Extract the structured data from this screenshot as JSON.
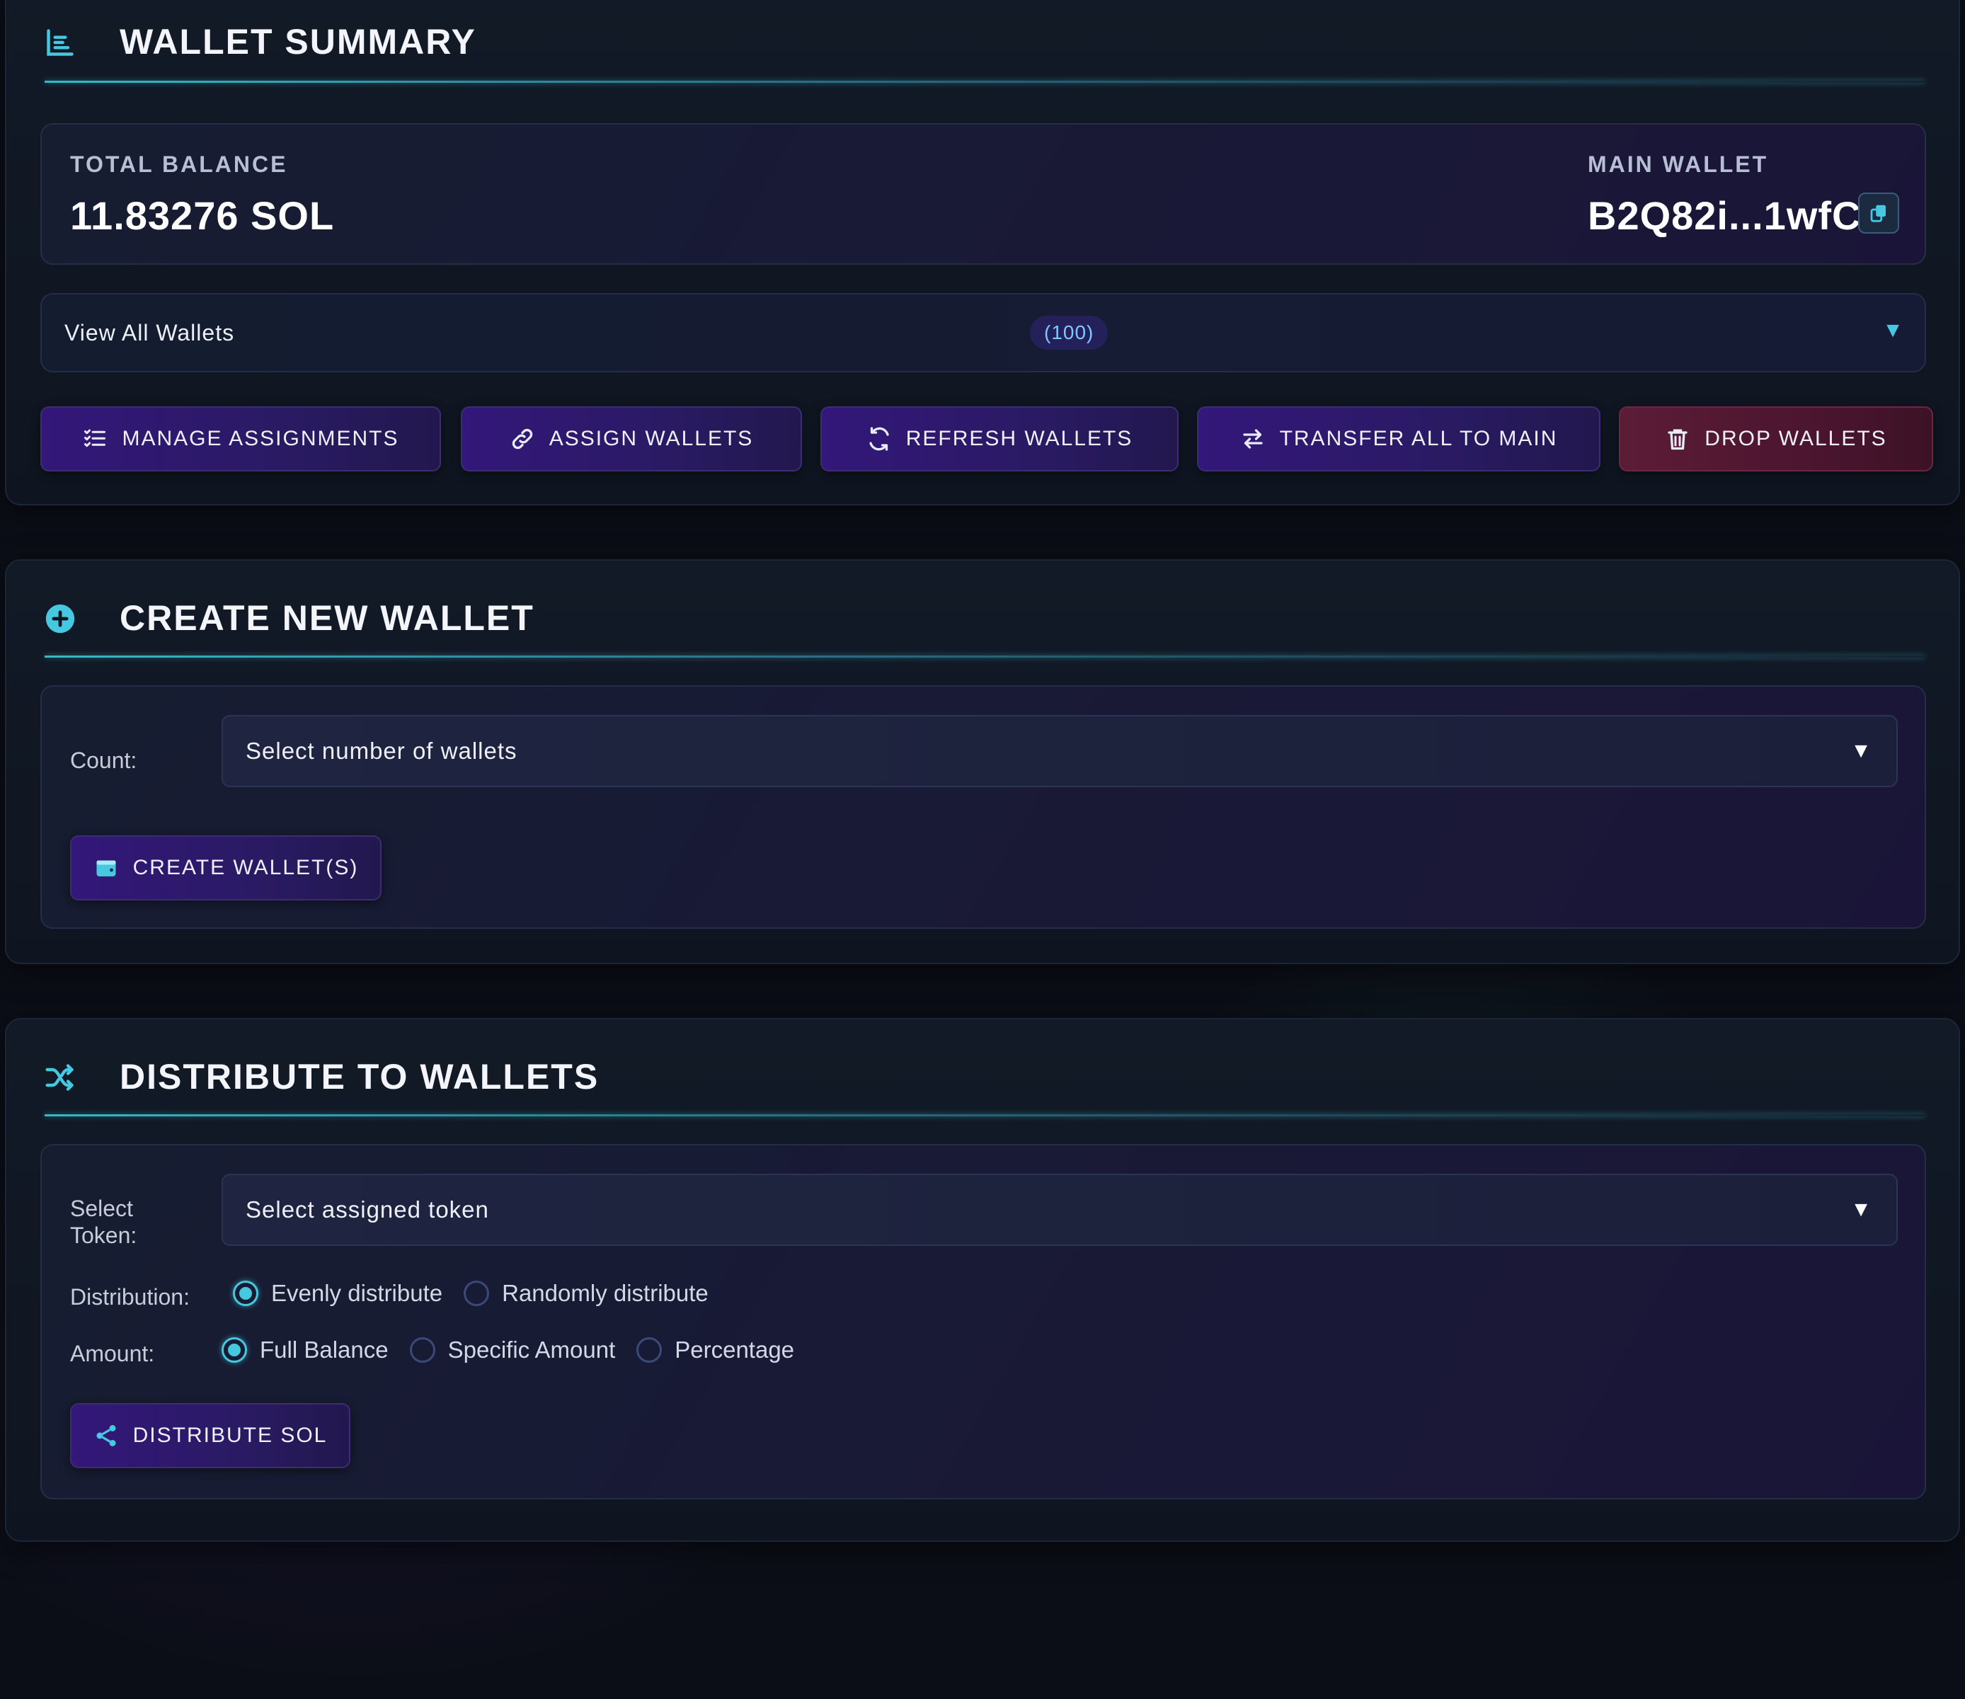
{
  "colors": {
    "accent": "#46c8e0",
    "primary_button": "#33177a",
    "danger_button": "#5c1c36",
    "background": "#0b0e16"
  },
  "wallet_summary": {
    "title": "WALLET SUMMARY",
    "icon": "chart-list-icon",
    "total_balance_label": "TOTAL BALANCE",
    "total_balance_value": "11.83276 SOL",
    "main_wallet_label": "MAIN WALLET",
    "main_wallet_value": "B2Q82i...1wfC",
    "copy_icon": "copy-icon",
    "view_all": {
      "label": "View All Wallets",
      "count": "(100)",
      "caret": "▼"
    },
    "buttons": [
      {
        "label": "MANAGE ASSIGNMENTS",
        "icon": "list-check-icon"
      },
      {
        "label": "ASSIGN WALLETS",
        "icon": "link-icon"
      },
      {
        "label": "REFRESH WALLETS",
        "icon": "refresh-icon"
      },
      {
        "label": "TRANSFER ALL TO MAIN",
        "icon": "transfer-icon"
      },
      {
        "label": "DROP WALLETS",
        "icon": "trash-icon"
      }
    ]
  },
  "create_wallet": {
    "title": "CREATE NEW WALLET",
    "icon": "plus-circle-icon",
    "count_label": "Count:",
    "count_select": {
      "value": "Select number of wallets",
      "caret": "▼"
    },
    "create_button": {
      "label": "CREATE WALLET(S)",
      "icon": "wallet-icon"
    }
  },
  "distribute": {
    "title": "DISTRIBUTE TO WALLETS",
    "icon": "shuffle-icon",
    "token_label_line1": "Select",
    "token_label_line2": "Token:",
    "token_select": {
      "value": "Select assigned token",
      "caret": "▼"
    },
    "distribution_label": "Distribution:",
    "distribution_options": [
      {
        "label": "Evenly distribute",
        "selected": true
      },
      {
        "label": "Randomly distribute",
        "selected": false
      }
    ],
    "amount_label": "Amount:",
    "amount_options": [
      {
        "label": "Full Balance",
        "selected": true
      },
      {
        "label": "Specific Amount",
        "selected": false
      },
      {
        "label": "Percentage",
        "selected": false
      }
    ],
    "distribute_button": {
      "label": "DISTRIBUTE SOL",
      "icon": "share-icon"
    }
  }
}
